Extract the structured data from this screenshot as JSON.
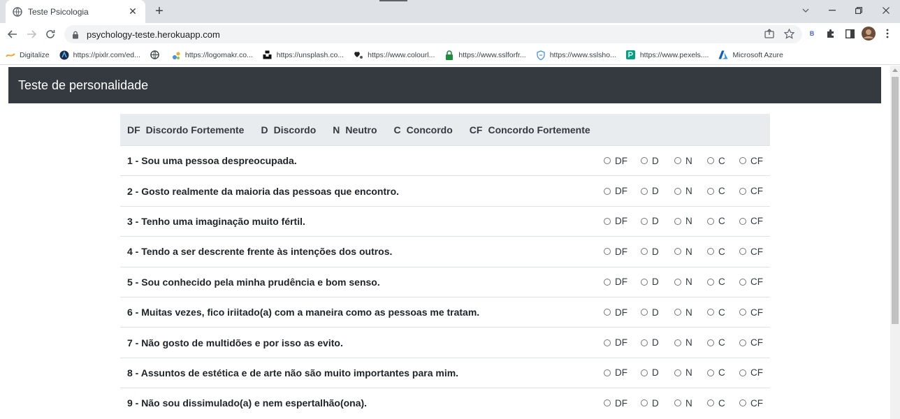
{
  "browser": {
    "tab_title": "Teste Psicologia",
    "tab_close": "✕",
    "new_tab": "+",
    "url": "psychology-teste.herokuapp.com",
    "bookmarks": [
      {
        "label": "Digitalize",
        "icon": "link-icon"
      },
      {
        "label": "https://pixlr.com/ed...",
        "icon": "pixlr-icon"
      },
      {
        "label": "",
        "icon": "globe-icon"
      },
      {
        "label": "https://logomakr.co...",
        "icon": "logomakr-icon"
      },
      {
        "label": "https://unsplash.co...",
        "icon": "unsplash-icon"
      },
      {
        "label": "https://www.colourl...",
        "icon": "colourlovers-icon"
      },
      {
        "label": "https://www.sslforfr...",
        "icon": "lock-icon"
      },
      {
        "label": "https://www.sslsho...",
        "icon": "shield-icon"
      },
      {
        "label": "https://www.pexels....",
        "icon": "pexels-icon"
      },
      {
        "label": "Microsoft Azure",
        "icon": "azure-icon"
      }
    ]
  },
  "page": {
    "brand": "Teste de personalidade",
    "legend": [
      {
        "code": "DF",
        "label": "Discordo Fortemente"
      },
      {
        "code": "D",
        "label": "Discordo"
      },
      {
        "code": "N",
        "label": "Neutro"
      },
      {
        "code": "C",
        "label": "Concordo"
      },
      {
        "code": "CF",
        "label": "Concordo Fortemente"
      }
    ],
    "options": [
      "DF",
      "D",
      "N",
      "C",
      "CF"
    ],
    "questions": [
      "1 - Sou uma pessoa despreocupada.",
      "2 - Gosto realmente da maioria das pessoas que encontro.",
      "3 - Tenho uma imaginação muito fértil.",
      "4 - Tendo a ser descrente frente às intenções dos outros.",
      "5 - Sou conhecido pela minha prudência e bom senso.",
      "6 - Muitas vezes, fico iriitado(a) com a maneira como as pessoas me tratam.",
      "7 - Não gosto de multidões e por isso as evito.",
      "8 - Assuntos de estética e de arte não são muito importantes para mim.",
      "9 - Não sou dissimulado(a) e nem espertalhão(ona)."
    ]
  },
  "colors": {
    "navbar_bg": "#343a40",
    "legend_bg": "#e9ecef",
    "row_border": "#dee2e6"
  }
}
